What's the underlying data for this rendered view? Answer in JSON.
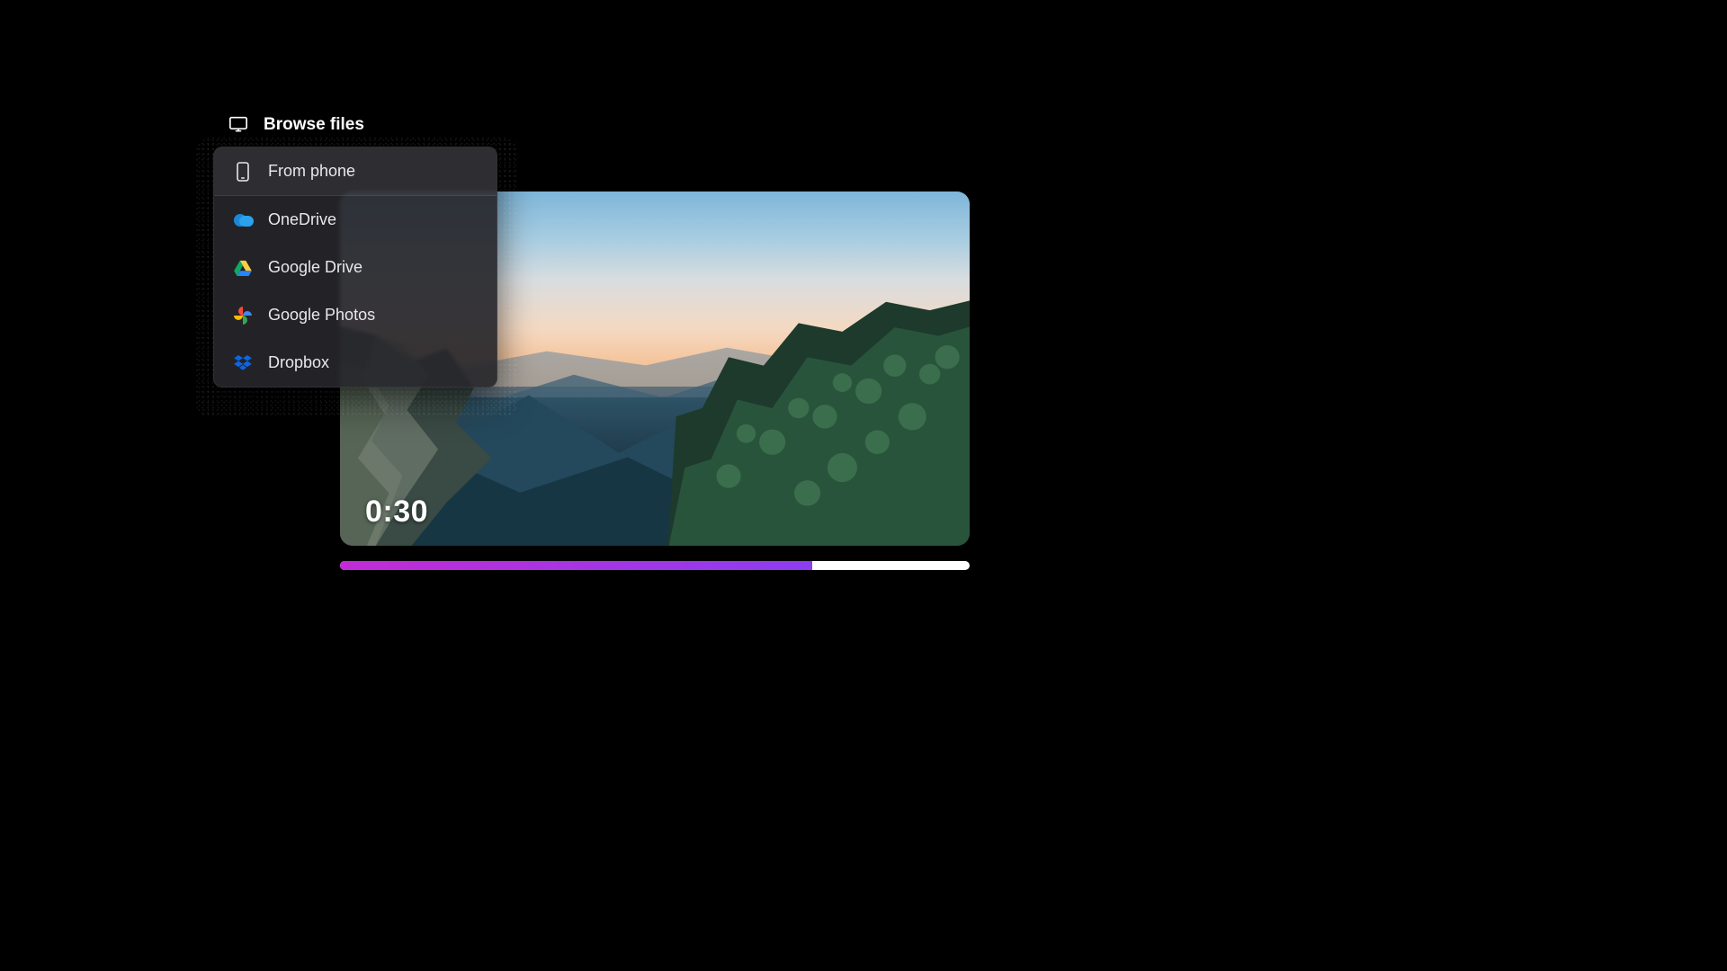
{
  "header": {
    "browse_label": "Browse files"
  },
  "menu": {
    "items": [
      {
        "label": "From phone"
      },
      {
        "label": "OneDrive"
      },
      {
        "label": "Google Drive"
      },
      {
        "label": "Google Photos"
      },
      {
        "label": "Dropbox"
      }
    ]
  },
  "video": {
    "timestamp": "0:30"
  },
  "progress": {
    "percent": 75
  },
  "colors": {
    "progress_start": "#c22bd6",
    "progress_end": "#8c3df0"
  }
}
